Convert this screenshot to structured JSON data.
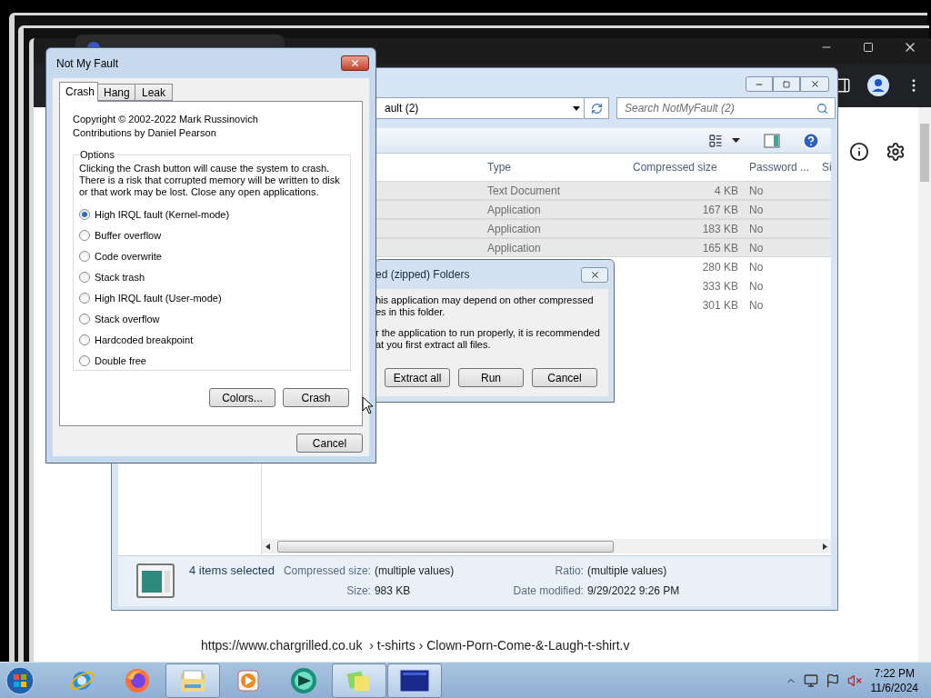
{
  "browser": {
    "status_url": "https://www.chargrilled.co.uk  › t-shirts › Clown-Porn-Come-&-Laugh-t-shirt.v"
  },
  "explorer": {
    "address": "ault (2)",
    "search_placeholder": "Search NotMyFault (2)",
    "columns": [
      "Type",
      "Compressed size",
      "Password ...",
      "Si"
    ],
    "rows": [
      {
        "type": "Text Document",
        "compressed_size": "4 KB",
        "password": "No",
        "selected": true
      },
      {
        "type": "Application",
        "compressed_size": "167 KB",
        "password": "No",
        "selected": true
      },
      {
        "type": "Application",
        "compressed_size": "183 KB",
        "password": "No",
        "selected": true
      },
      {
        "type": "Application",
        "compressed_size": "165 KB",
        "password": "No",
        "selected": true
      },
      {
        "compressed_size": "280 KB",
        "password": "No",
        "selected": false
      },
      {
        "compressed_size": "333 KB",
        "password": "No",
        "selected": false
      },
      {
        "compressed_size": "301 KB",
        "password": "No",
        "selected": false
      }
    ],
    "status": {
      "summary": "4 items selected",
      "fields": [
        {
          "label": "Compressed size:",
          "value": "(multiple values)"
        },
        {
          "label": "Ratio:",
          "value": "(multiple values)"
        },
        {
          "label": "Size:",
          "value": "983 KB"
        },
        {
          "label": "Date modified:",
          "value": "9/29/2022 9:26 PM"
        }
      ]
    }
  },
  "zip_dialog": {
    "title": "ed (zipped) Folders",
    "paragraphs": [
      [
        "his application may depend on other compressed",
        "es in this folder."
      ],
      [
        "r the application to run properly, it is recommended",
        "at you first extract all files."
      ]
    ],
    "buttons": [
      "Extract all",
      "Run",
      "Cancel"
    ]
  },
  "not_my_fault": {
    "title": "Not My Fault",
    "tabs": [
      {
        "label": "Crash",
        "selected": true
      },
      {
        "label": "Hang",
        "selected": false
      },
      {
        "label": "Leak",
        "selected": false
      }
    ],
    "credits": [
      "Copyright © 2002-2022 Mark Russinovich",
      "Contributions by Daniel Pearson"
    ],
    "group_label": "Options",
    "description": "Clicking the Crash button will cause the system to crash. There is a risk that corrupted memory will be written to disk or that work may be lost. Close any open applications.",
    "options": [
      {
        "label": "High IRQL fault (Kernel-mode)",
        "selected": true
      },
      {
        "label": "Buffer overflow",
        "selected": false
      },
      {
        "label": "Code overwrite",
        "selected": false
      },
      {
        "label": "Stack trash",
        "selected": false
      },
      {
        "label": "High IRQL fault (User-mode)",
        "selected": false
      },
      {
        "label": "Stack overflow",
        "selected": false
      },
      {
        "label": "Hardcoded breakpoint",
        "selected": false
      },
      {
        "label": "Double free",
        "selected": false
      }
    ],
    "buttons": [
      "Colors...",
      "Crash"
    ],
    "cancel": "Cancel"
  },
  "taskbar": {
    "apps": [
      {
        "kind": "ie",
        "active": false
      },
      {
        "kind": "firefox",
        "active": false
      },
      {
        "kind": "explorer",
        "active": true
      },
      {
        "kind": "media",
        "active": false
      },
      {
        "kind": "round",
        "active": false
      },
      {
        "kind": "notes",
        "active": true
      },
      {
        "kind": "window",
        "active": true
      }
    ],
    "time": "7:22 PM",
    "date": "11/6/2024"
  }
}
